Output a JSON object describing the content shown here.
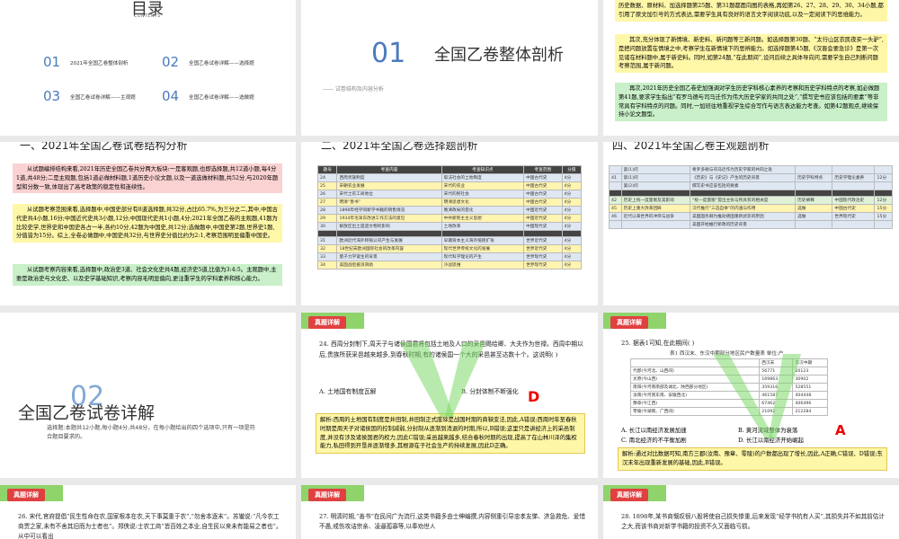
{
  "slide1": {
    "title": "目录",
    "subtitle": "CONTENTS",
    "items": [
      {
        "num": "01",
        "label": "2021年全国乙卷整体剖析"
      },
      {
        "num": "02",
        "label": "全国乙卷试卷详解——选择题"
      },
      {
        "num": "03",
        "label": "全国乙卷试卷详解——主观题"
      },
      {
        "num": "04",
        "label": "全国乙卷试卷详解——选做题"
      }
    ]
  },
  "slide2": {
    "num": "01",
    "title": "全国乙卷整体剖析",
    "subtitle": "—— 试卷结构及内容分析"
  },
  "slide3": {
    "p1": "历史数据、原材料、加选择题第25题、第31题都面向图的表格,再如第26、27、28、29、30、34小题,都引用了原文加引号的方式表达,需要学生具有良好的语言文字阅读功底,以及一定阅读下的思维能力。",
    "p2": "其次,充分体现了新情境、新史料、新问题等三新问题。如选择题第30题、“太行山区农民夜买一头驴”,是把问题放置在情境之中,考察学生在新情境下的思辨能力。如选择题第45题,《汉晋会要急诊》是第一次见诸在材料题中,属于新史料。同时,如第24题,“在此期间”,设问后续之具体导向问,需要学生自己判断问题考察范围,属于新问题。",
    "p3": "再次,2021年历史全国乙卷史加强调对学生历史学科核心素养的考察和历史学科特点的考察,如必做题第41题,要求学生指出“有罗马德与司马迁作为伟大历史学家的共同之处”,“撰写史书应该包括的要素”等非常具有学科特点的问题。同时,一加班往地重视学生综合写作与语言表达能力考查。如第42题观点,继续保持小论文题型。"
  },
  "slide4": {
    "heading": "一、2021年全国乙卷试卷结构分析",
    "p1": "从试题编排结构来看,2021年历史全国乙卷共分两大板块:一是客观题,也即选择题,共12道小题,每4分1道,共48分;二是主观题,包括1道必做材料题,1道历史小论文题,以及一道选做材料题,共52分,与2020年题型和分数一致,体现出了高考政策的稳定性和连续性。",
    "p2": "从试题考察范围来看,选择题中,中国史部分有8道选择题,共32分,占比65.7%,为三分之二,其中,中国古代史共4小题,16分;中国近代史共3小题,12分;中国现代史共1小题,4分;2021年全国乙卷的主观题,41题为比较史学,世界史和中国史各占一半,各约10分,42题为中国史,共12分;选做题中,中国史第2题,世界史1题,分值皆为15分。综上,全卷必做题中,中国史共32分,与世界史分值比约为2:1,考察范围明显偏重中国史。",
    "p3": "从试题考察内容来看,选择题中,政治史3道、社会文化史共4题,经济史5道,比值为3:4:5。主观题中,主要是政治史与文化史、以及史学基础知识,考察内容毛明显偏向,更注重学生的学科素养和核心能力。"
  },
  "slide5": {
    "heading": "二、2021年全国乙卷选择题剖析",
    "headers": [
      "题号",
      "考查内容",
      "考查知识点",
      "考查范围",
      "分值"
    ],
    "rows": [
      [
        "24",
        "西周贵族制度",
        "取法社会的土地制度",
        "中国古代史",
        "4分"
      ],
      [
        "25",
        "宋朝农业发展",
        "宋代的农业",
        "中国古代史",
        "4分"
      ],
      [
        "26",
        "宋代士农工商地位",
        "宋代的民社会",
        "中国古代史",
        "4分"
      ],
      [
        "27",
        "明清“善书”",
        "明清思想文化",
        "中国古代史",
        "4分"
      ],
      [
        "28",
        "1898年经学同新学书籍的销售情况",
        "晚清政局的变化",
        "中国近代史",
        "4分"
      ],
      [
        "29",
        "1934年毛泽东改进工作方法的意见",
        "中共新民主主义思想",
        "中国近代史",
        "4分"
      ],
      [
        "30",
        "解放区出土遗迹文物的影响",
        "土地改革",
        "中国现代史",
        "4分"
      ],
      [
        "",
        "",
        "",
        "",
        ""
      ],
      [
        "31",
        "欧洲近代海外移殖公司产生与发展",
        "早期资本主义海外殖民扩张",
        "世界近代史",
        "4分"
      ],
      [
        "32",
        "18世纪末欧洲国际社会的改革内容",
        "现代世界传统文化的发展",
        "世界近代史",
        "4分"
      ],
      [
        "33",
        "量子力学诞生的背景",
        "现代科学理论的产生",
        "世界现代史",
        "4分"
      ],
      [
        "34",
        "美国战后援派资助",
        "冷战思维",
        "世界现代史",
        "4分"
      ]
    ]
  },
  "slide6": {
    "heading": "四、2021年全国乙卷主观题剖析",
    "rows": [
      [
        "",
        "第(1)问",
        "希罗多德与司马迁作为历史学家的共同之处",
        "",
        "",
        ""
      ],
      [
        "41",
        "第(1)问",
        "《历史》与《史记》产生的历史背景",
        "历史学科特点",
        "历史学理论素养",
        "12分"
      ],
      [
        "",
        "第(2)问",
        "撰写史书应该包括的要素",
        "",
        "",
        ""
      ],
      [
        "",
        "",
        "",
        "",
        "",
        ""
      ],
      [
        "42",
        "历史上统一度量衡及其影响",
        "“统一度量衡”提出主张与所具有的相关度",
        "历史阐释",
        "中国现代政治史",
        "12分"
      ],
      [
        "45",
        "历史上重大改革回眸",
        "汉代推行“三选自举”的内涵与作用",
        "选做",
        "中国古代史",
        "15分"
      ],
      [
        "46",
        "近代以来世界的冲突与战争",
        "美国国务卿为推动德国重新武装的原因",
        "选做",
        "世界现代史",
        "15分"
      ],
      [
        "",
        "",
        "美国开始推行新政的历史背景",
        "",
        "",
        ""
      ]
    ]
  },
  "slide7": {
    "num": "02",
    "title": "全国乙卷试卷详解",
    "desc": "选择题:本题共12小题,每小题4分,共48分。在每小题给出的四个选项中,只有一项是符合题目要求的。"
  },
  "slide8": {
    "badge": "真题详解",
    "question": "24. 西周分封制下,周天子与诸侯国君将包括土地及人口的采邑赐给卿、大夫作为世禄。西周中期以后,贵族所获采邑越来越多,到春秋时期,有的诸侯国一个大的采邑甚至达数十个。这说明(    )",
    "optA": "A. 土地国有制度瓦解",
    "optB": "B. 分封体制不断强化",
    "answer": "D",
    "analysis": "解析:西周的土地国有制度是井田制,井田制正式废除是战国时期的商鞅变法,因此,A错误;西周时年至春秋时期是周天子对诸侯国的控制减弱,分封制从逐渐到消退的时期,所以,B错误;这里只是讲经济上的采邑制度,并没有涉及诸侯国君的权力,因此C错误;采邑越来越多,结合春秋时期的出现,提高了在山林川泽的集权能力,私田得到开垦并逐渐增多,其根源在于社会生产的持续发展,因此D正确。"
  },
  "slide9": {
    "badge": "真题详解",
    "question": "25. 据表1可知,在此期间(    )",
    "table_title": "表1  西汉末、东汉中期部分地区民户数量表  单位:户",
    "headers": [
      "",
      "西汉末",
      "东汉中期"
    ],
    "rows": [
      [
        "代郡(今河北、山西间)",
        "56771",
        "20123"
      ],
      [
        "太原(今山西)",
        "169863",
        "30902"
      ],
      [
        "南阳(今河南南部及湖北、陕西部分地区)",
        "359316",
        "528551"
      ],
      [
        "汝南(今河南东南、安徽西北)",
        "461587",
        "404448"
      ],
      [
        "豫章(今江西)",
        "67462",
        "406496"
      ],
      [
        "零陵(今湖南、广西间)",
        "21092",
        "212284"
      ]
    ],
    "optA": "A. 长江以南经济发展加速",
    "optB": "B. 黄河流域整体为衰落",
    "optC": "C. 南北经济的不平衡加剧",
    "optD": "D. 长江以南经济开始崛起",
    "answer": "A",
    "analysis": "解析:通过对比数据可知,南方三郡(汝南、豫章、零陵)的户数都出现了增长,因此,A正确,C错误、D错误;东汉末年出现重新发展的基础,因此,B错误。"
  },
  "slide10": {
    "badge": "真题详解",
    "question": "26. 宋代,官府提倡“民生性命在农,国家根本在农,天下事莫重于农”,“勿舍本逐末”。苏辙说:“凡今农工商贾之家,未有不舍其旧而为士者也”。郑侠说:士农工商“皆百姓之本业,自生民以来未有能易之者也”。从中可以看出"
  },
  "slide11": {
    "badge": "真题详解",
    "question": "27. 明清时期,“善书”在民间广为流行,这类书籍多由士绅编撰,内容侧重引导忠孝友悌、济急救危、爱惜不愚,戒伤攻诘宗亲、凌逼孤寡等,以奉劝世人"
  },
  "slide12": {
    "badge": "真题详解",
    "question": "28. 1898年,某书商慨叹很八股将使自己损失惨重,后来发现“经学书杭有人买”,其损失并不如其前估计之大,而该书商对新学书籍的投资不久又面临亏损。"
  }
}
